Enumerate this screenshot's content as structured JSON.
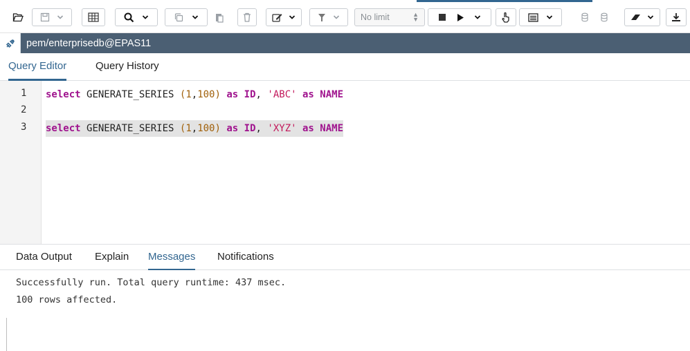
{
  "toolbar": {
    "buttons": [
      "open-file",
      "save-file",
      "save-dropdown",
      "find-replace",
      "find",
      "find-dropdown",
      "copy",
      "copy-dropdown",
      "paste",
      "delete",
      "edit",
      "filter",
      "filter-dropdown",
      "stop",
      "execute",
      "execute-dropdown",
      "pan",
      "explain",
      "explain-dropdown",
      "commit",
      "rollback",
      "clear",
      "download"
    ],
    "limit_select": {
      "value": "No limit"
    }
  },
  "connection": {
    "label": "pem/enterprisedb@EPAS11",
    "icon": "connection-icon"
  },
  "editor_tabs": [
    {
      "label": "Query Editor",
      "active": true
    },
    {
      "label": "Query History",
      "active": false
    }
  ],
  "code": {
    "line_numbers": [
      "1",
      "2",
      "3"
    ],
    "lines": [
      {
        "kw1": "select",
        "fn": "GENERATE_SERIES",
        "p1": "(",
        "n1": "1",
        "c": ",",
        "n2": "100",
        "p2": ")",
        "kw2": "as",
        "id": "ID",
        "comma": ",",
        "str": "'ABC'",
        "kw3": "as",
        "name": "NAME"
      },
      {
        "kw1": "select",
        "fn": "GENERATE_SERIES",
        "p1": "(",
        "n1": "1",
        "c": ",",
        "n2": "100",
        "p2": ")",
        "kw2": "as",
        "id": "ID",
        "comma": ",",
        "str": "'XYZ'",
        "kw3": "as",
        "name": "NAME"
      }
    ]
  },
  "result_tabs": [
    {
      "label": "Data Output",
      "active": false
    },
    {
      "label": "Explain",
      "active": false
    },
    {
      "label": "Messages",
      "active": true
    },
    {
      "label": "Notifications",
      "active": false
    }
  ],
  "messages": [
    "Successfully run. Total query runtime: 437 msec.",
    "100 rows affected."
  ],
  "colors": {
    "accent": "#326690",
    "connection_bar": "#4b5f73",
    "keyword": "#a0148e",
    "number": "#a0600a",
    "string": "#c2185b"
  }
}
